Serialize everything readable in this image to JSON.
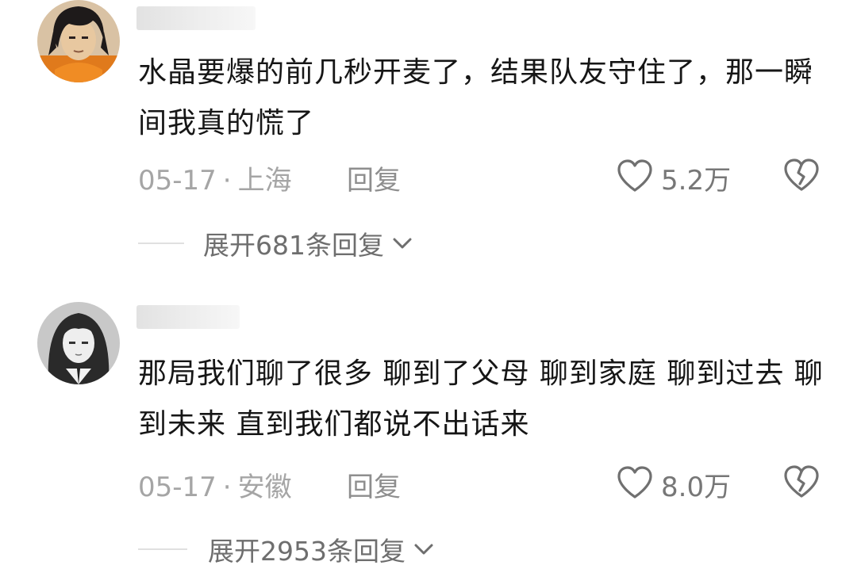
{
  "comments": [
    {
      "content": "水晶要爆的前几秒开麦了，结果队友守住了，那一瞬间我真的慌了",
      "date": "05-17",
      "separator": "·",
      "location": "上海",
      "reply_label": "回复",
      "likes": "5.2万",
      "expand_label": "展开681条回复"
    },
    {
      "content": "那局我们聊了很多 聊到了父母 聊到家庭 聊到过去 聊到未来 直到我们都说不出话来",
      "date": "05-17",
      "separator": "·",
      "location": "安徽",
      "reply_label": "回复",
      "likes": "8.0万",
      "expand_label": "展开2953条回复"
    }
  ],
  "colors": {
    "text": "#161616",
    "meta": "#a5a5a5",
    "icon": "#707070"
  },
  "icons": [
    "heart-outline-icon",
    "broken-heart-icon",
    "chevron-down-icon"
  ]
}
